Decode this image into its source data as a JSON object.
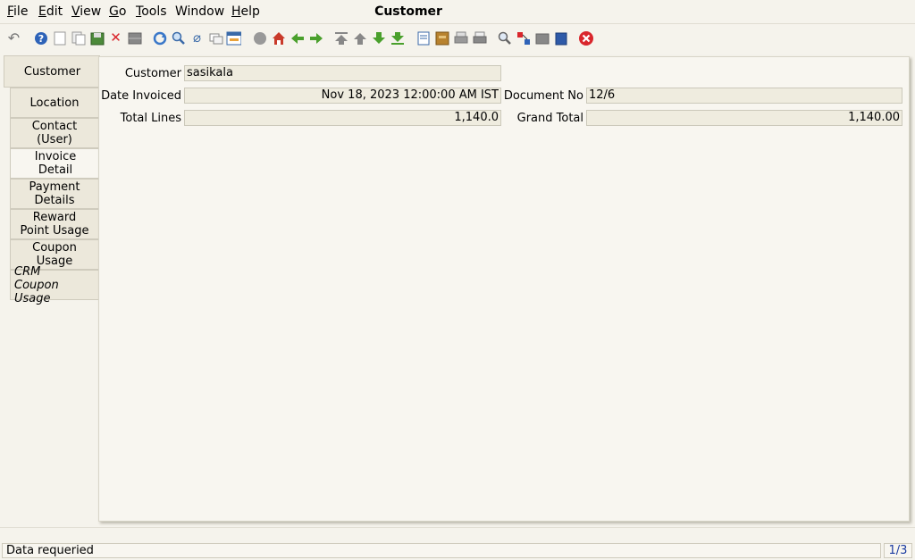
{
  "window": {
    "title": "Customer"
  },
  "menu": {
    "file": {
      "accel": "F",
      "rest": "ile"
    },
    "edit": {
      "accel": "E",
      "rest": "dit"
    },
    "view": {
      "accel": "V",
      "rest": "iew"
    },
    "go": {
      "accel": "G",
      "rest": "o"
    },
    "tools": {
      "accel": "T",
      "rest": "ools"
    },
    "window": {
      "pre": "Window"
    },
    "help": {
      "accel": "H",
      "rest": "elp"
    }
  },
  "toolbar": {
    "icons": [
      "undo-icon",
      "help-icon",
      "new-record-icon",
      "copy-record-icon",
      "save-icon",
      "delete-icon",
      "grid-toggle-icon",
      "refresh-icon",
      "find-icon",
      "attachment-icon",
      "chat-icon",
      "history-icon",
      "home-icon",
      "parent-icon",
      "previous-tab-icon",
      "next-tab-icon",
      "first-record-icon",
      "previous-record-icon",
      "next-record-icon",
      "last-record-icon",
      "report-icon",
      "archive-icon",
      "print-preview-icon",
      "print-icon",
      "zoom-icon",
      "workflow-icon",
      "product-info-icon",
      "request-icon",
      "exit-icon"
    ]
  },
  "tabs": [
    {
      "line1": "Customer",
      "line2": ""
    },
    {
      "line1": "Location",
      "line2": ""
    },
    {
      "line1": "Contact",
      "line2": "(User)"
    },
    {
      "line1": "Invoice",
      "line2": "Detail"
    },
    {
      "line1": "Payment",
      "line2": "Details"
    },
    {
      "line1": "Reward",
      "line2": "Point Usage"
    },
    {
      "line1": "Coupon",
      "line2": "Usage"
    },
    {
      "line1": "CRM",
      "line2": "Coupon Usage"
    }
  ],
  "form": {
    "customer": {
      "label": "Customer",
      "value": "sasikala"
    },
    "date_invoiced": {
      "label": "Date Invoiced",
      "value": "Nov 18, 2023 12:00:00 AM IST"
    },
    "document_no": {
      "label": "Document No",
      "value": "12/6"
    },
    "total_lines": {
      "label": "Total Lines",
      "value": "1,140.0"
    },
    "grand_total": {
      "label": "Grand Total",
      "value": "1,140.00"
    }
  },
  "status": {
    "message": "Data requeried",
    "page": "1/3"
  },
  "colors": {
    "background": "#f5f3ec",
    "field": "#efecdf",
    "page_indicator": "#1a3aa0",
    "exit_red": "#d9262c",
    "nav_green": "#4aa02c"
  }
}
